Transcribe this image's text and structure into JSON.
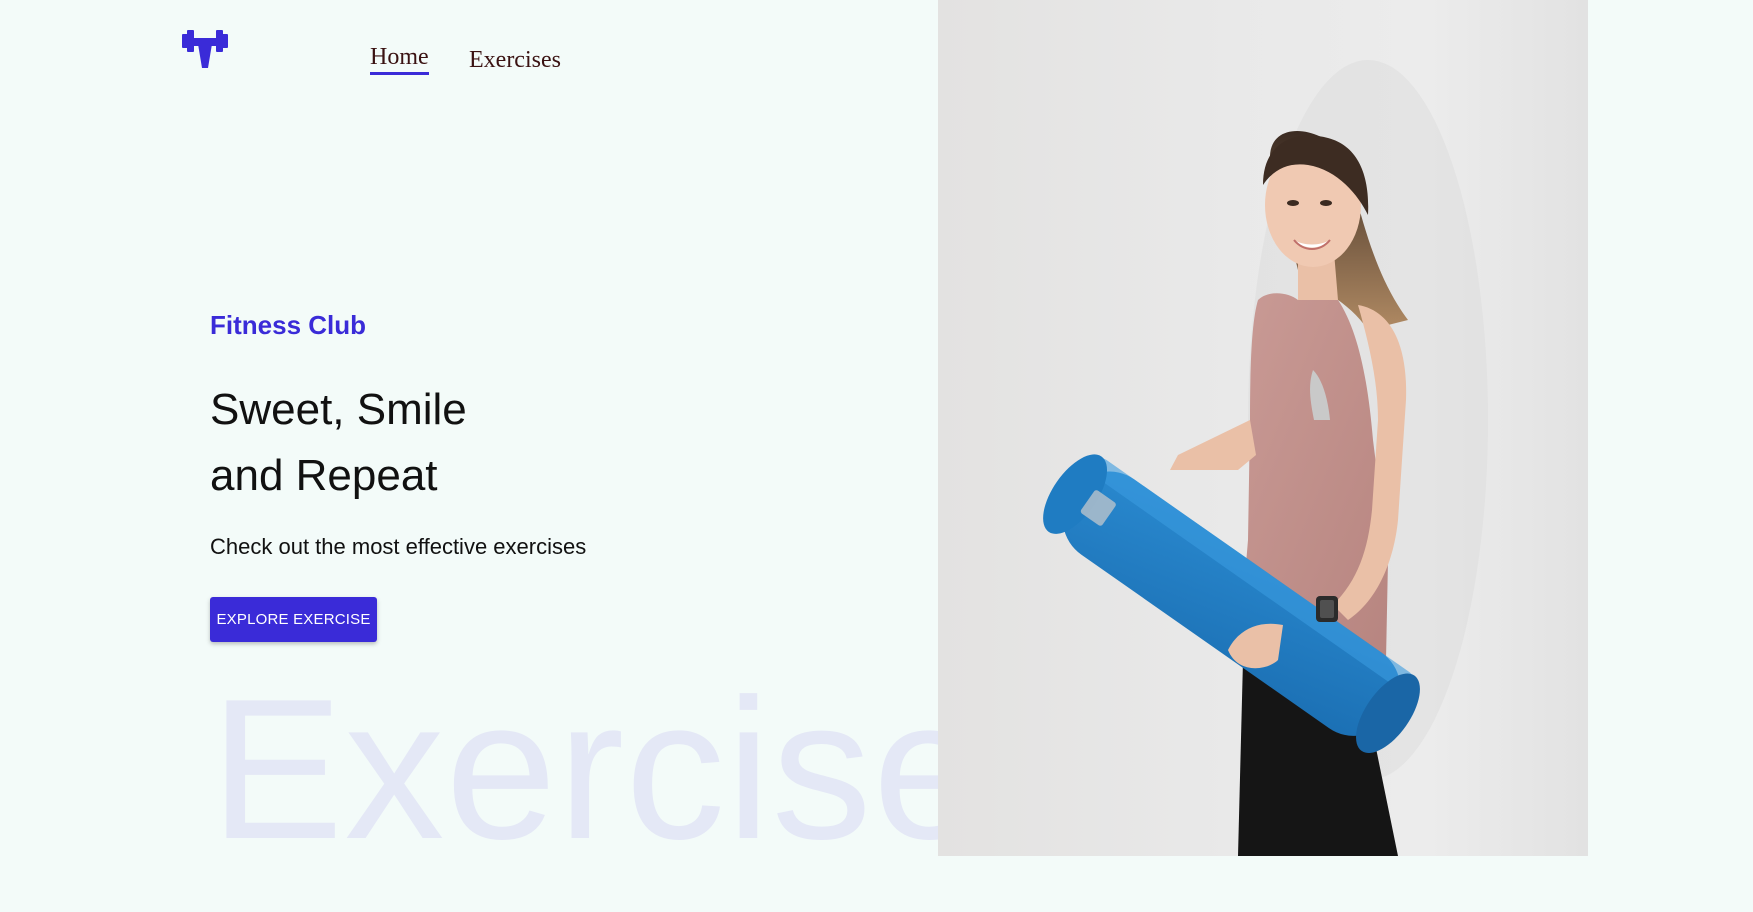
{
  "brand": {
    "logo_icon": "dumbbell-icon",
    "accent_color": "#3a2bd8"
  },
  "nav": {
    "items": [
      {
        "label": "Home",
        "active": true
      },
      {
        "label": "Exercises",
        "active": false
      }
    ]
  },
  "hero": {
    "subtitle": "Fitness Club",
    "headline_line1": "Sweet, Smile",
    "headline_line2": "and Repeat",
    "tagline": "Check out the most effective exercises",
    "cta_label": "EXPLORE EXERCISE",
    "watermark": "Exercise",
    "image_alt": "woman holding a blue yoga mat"
  }
}
